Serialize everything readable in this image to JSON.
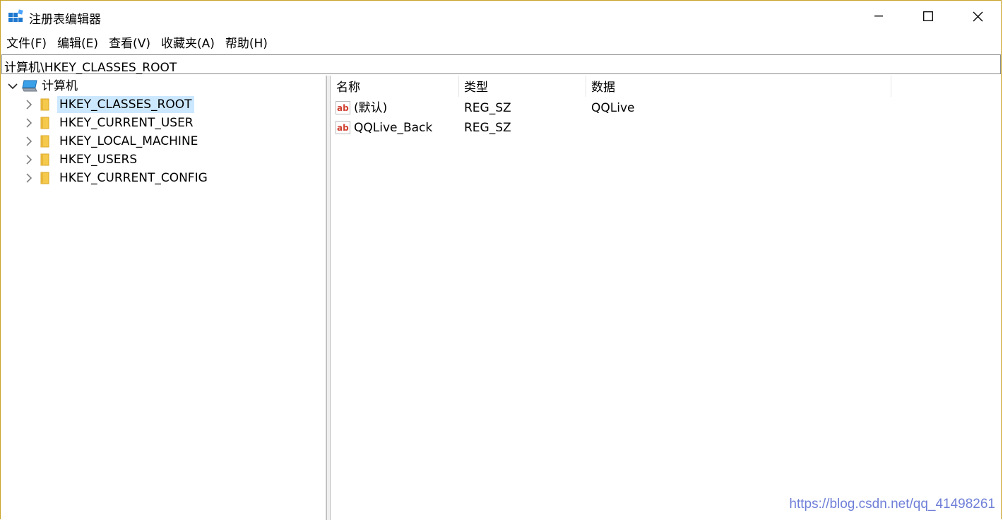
{
  "window": {
    "title": "注册表编辑器"
  },
  "menu": [
    "文件(F)",
    "编辑(E)",
    "查看(V)",
    "收藏夹(A)",
    "帮助(H)"
  ],
  "address": "计算机\\HKEY_CLASSES_ROOT",
  "tree": {
    "root": "计算机",
    "items": [
      "HKEY_CLASSES_ROOT",
      "HKEY_CURRENT_USER",
      "HKEY_LOCAL_MACHINE",
      "HKEY_USERS",
      "HKEY_CURRENT_CONFIG"
    ],
    "selected": "HKEY_CLASSES_ROOT"
  },
  "columns": {
    "name": "名称",
    "type": "类型",
    "data": "数据"
  },
  "values": [
    {
      "name": "(默认)",
      "type": "REG_SZ",
      "data": "QQLive"
    },
    {
      "name": "QQLive_Back",
      "type": "REG_SZ",
      "data": ""
    }
  ],
  "watermark": "https://blog.csdn.net/qq_41498261",
  "colors": {
    "selection": "#cce8ff",
    "folder": "#f5c94b",
    "watermark": "#6f7fd8"
  },
  "icons": [
    "regedit-app-icon",
    "minimize-icon",
    "maximize-icon",
    "close-icon",
    "computer-icon",
    "folder-icon",
    "chevron-right-icon",
    "chevron-down-icon",
    "string-value-icon"
  ]
}
